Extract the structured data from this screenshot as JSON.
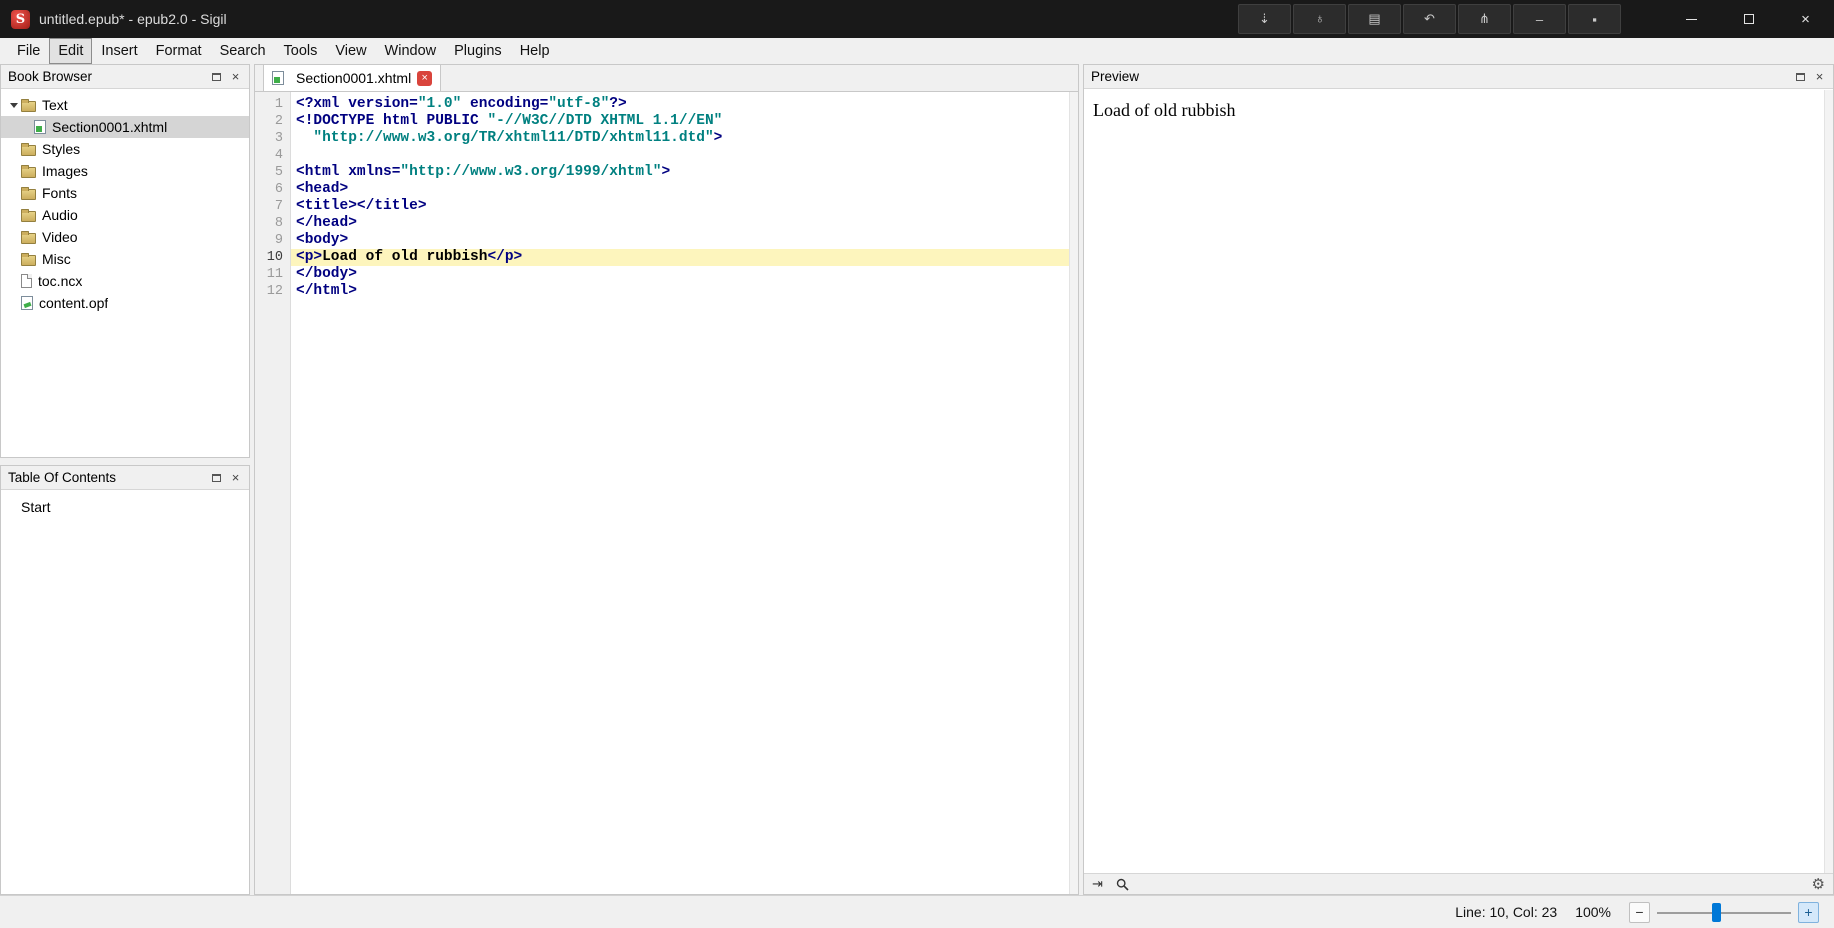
{
  "colors": {
    "titlebar_bg": "#191919",
    "tag": "#000080",
    "string": "#008080",
    "plain": "#000000",
    "current_line_bg": "#fdf5bd",
    "selection_bg": "#d5d5d5",
    "close_red": "#d9443c",
    "slider_blue": "#0078d7",
    "panel_bg": "#f0f0f0"
  },
  "window": {
    "title": "untitled.epub* - epub2.0 - Sigil"
  },
  "titlebar_toolbar": [
    {
      "name": "snap-down",
      "glyph": "⇣"
    },
    {
      "name": "plug",
      "glyph": "♀",
      "rotate": true
    },
    {
      "name": "panel-list",
      "glyph": "▤"
    },
    {
      "name": "undo-arrow",
      "glyph": "↶"
    },
    {
      "name": "fork",
      "glyph": "⋔"
    },
    {
      "name": "dash",
      "glyph": "–"
    },
    {
      "name": "record-dot",
      "glyph": "▪"
    }
  ],
  "menubar": {
    "items": [
      "File",
      "Edit",
      "Insert",
      "Format",
      "Search",
      "Tools",
      "View",
      "Window",
      "Plugins",
      "Help"
    ],
    "active": "Edit"
  },
  "book_browser": {
    "title": "Book Browser",
    "items": [
      {
        "label": "Text",
        "icon": "folder",
        "level": 0,
        "expanded": true
      },
      {
        "label": "Section0001.xhtml",
        "icon": "html",
        "level": 1,
        "selected": true
      },
      {
        "label": "Styles",
        "icon": "folder",
        "level": 0
      },
      {
        "label": "Images",
        "icon": "folder",
        "level": 0
      },
      {
        "label": "Fonts",
        "icon": "folder",
        "level": 0
      },
      {
        "label": "Audio",
        "icon": "folder",
        "level": 0
      },
      {
        "label": "Video",
        "icon": "folder",
        "level": 0
      },
      {
        "label": "Misc",
        "icon": "folder",
        "level": 0
      },
      {
        "label": "toc.ncx",
        "icon": "file",
        "level": 0
      },
      {
        "label": "content.opf",
        "icon": "opf",
        "level": 0
      }
    ]
  },
  "toc": {
    "title": "Table Of Contents",
    "items": [
      {
        "label": "Start"
      }
    ]
  },
  "editor": {
    "tab_label": "Section0001.xhtml",
    "current_line": 10,
    "lines": [
      {
        "n": 1,
        "seg": [
          [
            "tag",
            "<?xml version="
          ],
          [
            "str",
            "\"1.0\""
          ],
          [
            "tag",
            " encoding="
          ],
          [
            "str",
            "\"utf-8\""
          ],
          [
            "tag",
            "?>"
          ]
        ]
      },
      {
        "n": 2,
        "seg": [
          [
            "tag",
            "<!DOCTYPE html PUBLIC "
          ],
          [
            "str",
            "\"-//W3C//DTD XHTML 1.1//EN\""
          ]
        ]
      },
      {
        "n": 3,
        "seg": [
          [
            "str",
            "  \"http://www.w3.org/TR/xhtml11/DTD/xhtml11.dtd\""
          ],
          [
            "tag",
            ">"
          ]
        ]
      },
      {
        "n": 4,
        "seg": []
      },
      {
        "n": 5,
        "seg": [
          [
            "tag",
            "<html xmlns="
          ],
          [
            "str",
            "\"http://www.w3.org/1999/xhtml\""
          ],
          [
            "tag",
            ">"
          ]
        ]
      },
      {
        "n": 6,
        "seg": [
          [
            "tag",
            "<head>"
          ]
        ]
      },
      {
        "n": 7,
        "seg": [
          [
            "tag",
            "<title></title>"
          ]
        ]
      },
      {
        "n": 8,
        "seg": [
          [
            "tag",
            "</head>"
          ]
        ]
      },
      {
        "n": 9,
        "seg": [
          [
            "tag",
            "<body>"
          ]
        ]
      },
      {
        "n": 10,
        "seg": [
          [
            "tag",
            "<p>"
          ],
          [
            "txt",
            "Load of old rubbish"
          ],
          [
            "tag",
            "</p>"
          ]
        ]
      },
      {
        "n": 11,
        "seg": [
          [
            "tag",
            "</body>"
          ]
        ]
      },
      {
        "n": 12,
        "seg": [
          [
            "tag",
            "</html>"
          ]
        ]
      }
    ]
  },
  "preview": {
    "title": "Preview",
    "text": "Load of old rubbish"
  },
  "statusbar": {
    "cursor": "Line: 10, Col: 23",
    "zoom": "100%"
  }
}
